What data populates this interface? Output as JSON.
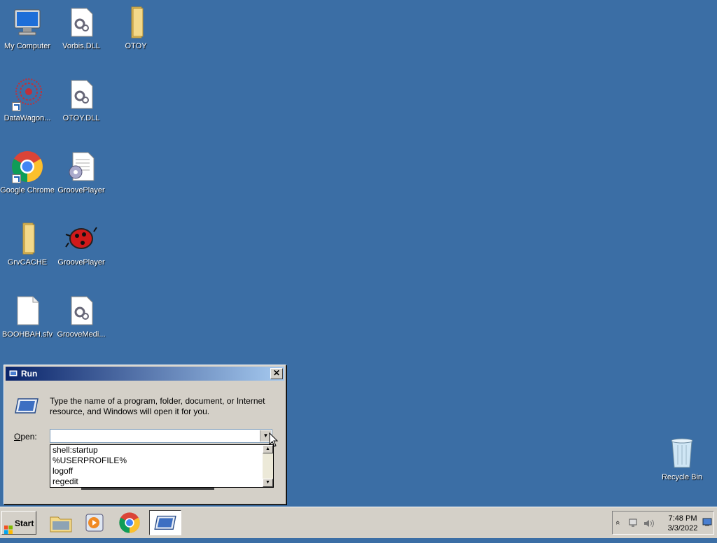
{
  "desktop": {
    "icons": [
      {
        "label": "My Computer"
      },
      {
        "label": "Vorbis.DLL"
      },
      {
        "label": "OTOY"
      },
      {
        "label": "DataWagon..."
      },
      {
        "label": "OTOY.DLL"
      },
      {
        "label": "Google Chrome"
      },
      {
        "label": "GroovePlayer"
      },
      {
        "label": "GrvCACHE"
      },
      {
        "label": "GroovePlayer"
      },
      {
        "label": "BOOHBAH.sfv"
      },
      {
        "label": "GrooveMedi..."
      }
    ],
    "recycle_bin": {
      "label": "Recycle Bin"
    }
  },
  "run_dialog": {
    "title": "Run",
    "close_label": "✕",
    "description": "Type the name of a program, folder, document, or Internet resource, and Windows will open it for you.",
    "open_label_prefix": "O",
    "open_label_rest": "pen:",
    "open_value": "",
    "history": [
      "shell:startup",
      "%USERPROFILE%",
      "logoff",
      "regedit"
    ]
  },
  "taskbar": {
    "start_label": "Start",
    "clock_time": "7:48 PM",
    "clock_date": "3/3/2022",
    "tray_expand": "«"
  },
  "colors": {
    "desktop": "#3b6ea5",
    "title_start": "#0a246a",
    "title_end": "#a6caf0",
    "window_face": "#d4d0c8"
  }
}
